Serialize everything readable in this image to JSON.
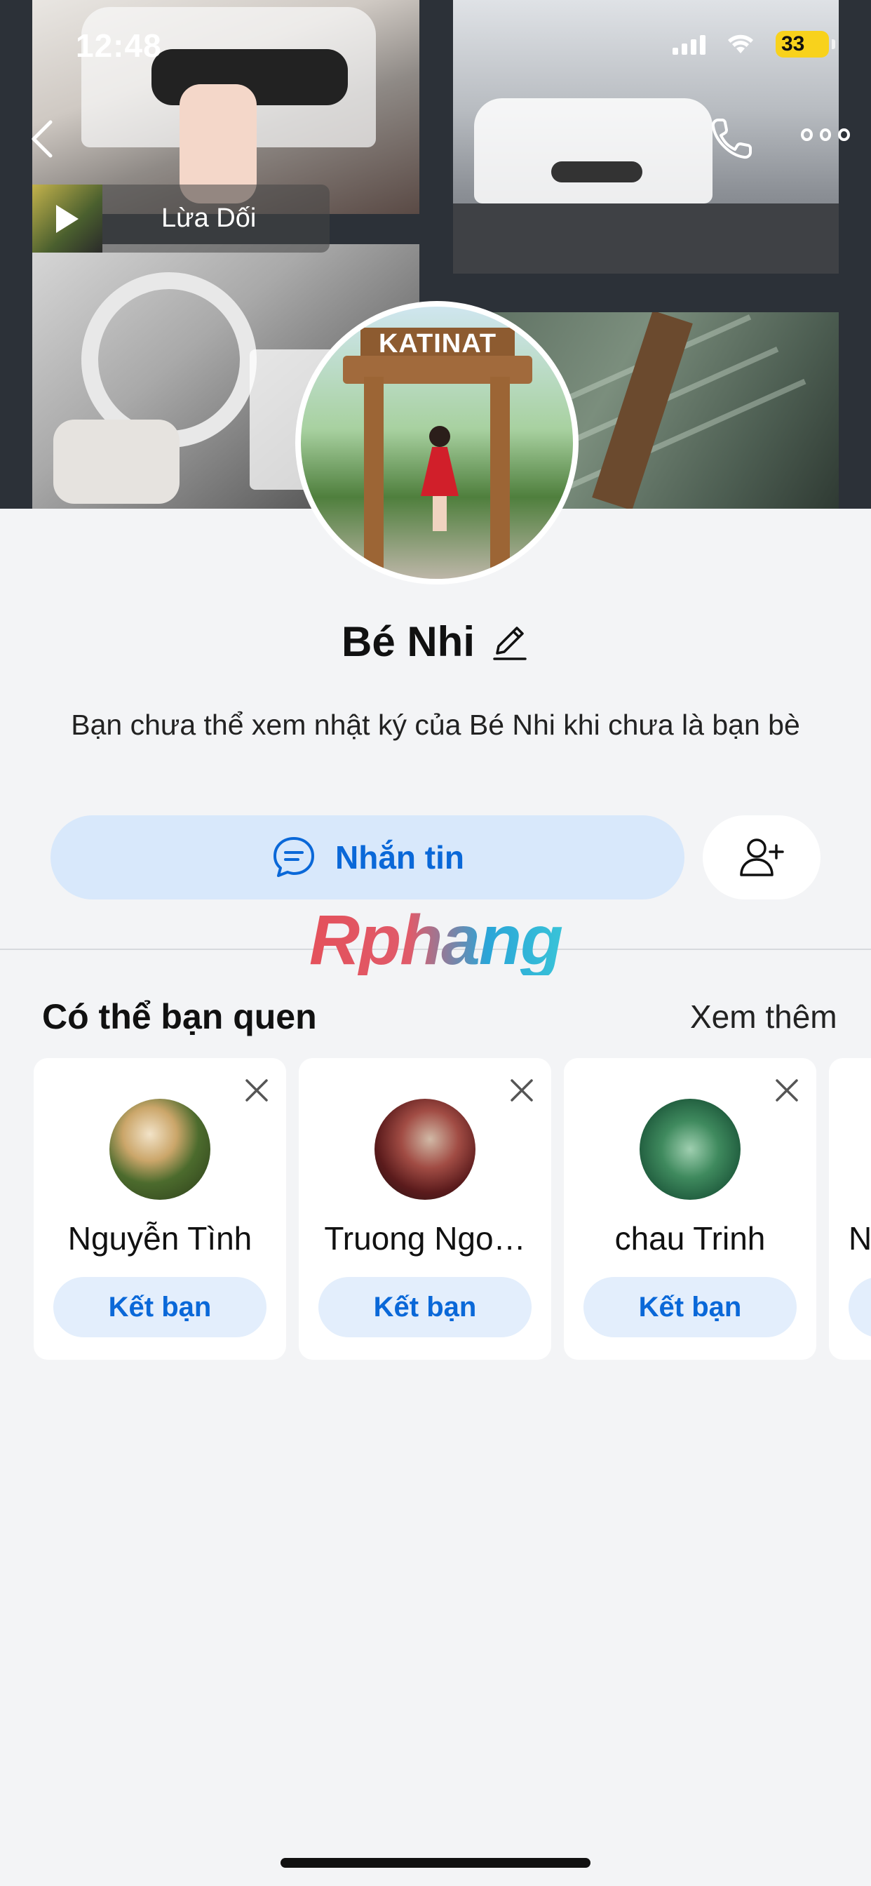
{
  "status_bar": {
    "time": "12:48",
    "battery": "33"
  },
  "cover": {
    "music_title": "Lừa Dối",
    "avatar_sign": "KATINAT"
  },
  "profile": {
    "name": "Bé Nhi",
    "description": "Bạn chưa thể xem nhật ký của Bé Nhi khi chưa là bạn bè",
    "message_label": "Nhắn tin"
  },
  "watermark": "Rphang",
  "suggestions": {
    "title": "Có thể bạn quen",
    "see_more": "Xem thêm",
    "items": [
      {
        "name": "Nguyễn Tình",
        "button": "Kết bạn"
      },
      {
        "name": "Truong Ngo…",
        "button": "Kết bạn"
      },
      {
        "name": "chau Trinh",
        "button": "Kết bạn"
      },
      {
        "name": "N",
        "button": ""
      }
    ]
  },
  "colors": {
    "accent": "#0a68d8",
    "message_bg": "#d8e8fb",
    "battery": "#f8d21c"
  }
}
